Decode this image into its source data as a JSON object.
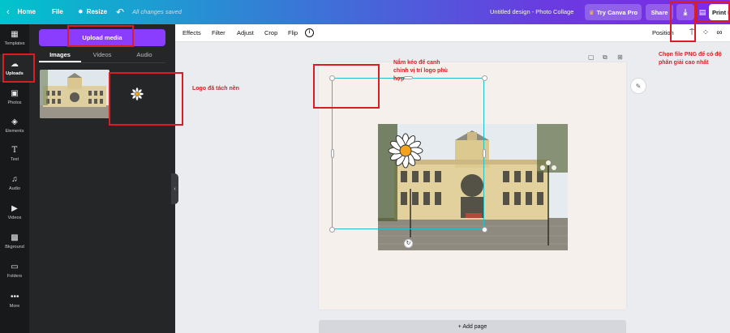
{
  "header": {
    "home": "Home",
    "file": "File",
    "resize": "Resize",
    "saved_status": "All changes saved",
    "design_title": "Untitled design - Photo Collage",
    "try_pro": "Try Canva Pro",
    "share": "Share",
    "print": "Print P"
  },
  "rail": {
    "items": [
      {
        "label": "Templates",
        "icon": "templates-icon"
      },
      {
        "label": "Uploads",
        "icon": "cloud-upload-icon"
      },
      {
        "label": "Photos",
        "icon": "image-icon"
      },
      {
        "label": "Elements",
        "icon": "shapes-icon"
      },
      {
        "label": "Text",
        "icon": "text-icon"
      },
      {
        "label": "Audio",
        "icon": "music-note-icon"
      },
      {
        "label": "Videos",
        "icon": "video-icon"
      },
      {
        "label": "Bkground",
        "icon": "background-icon"
      },
      {
        "label": "Folders",
        "icon": "folder-icon"
      },
      {
        "label": "More",
        "icon": "more-dots-icon"
      }
    ]
  },
  "panel": {
    "upload_button": "Upload media",
    "tabs": [
      {
        "label": "Images",
        "active": true
      },
      {
        "label": "Videos",
        "active": false
      },
      {
        "label": "Audio",
        "active": false
      }
    ]
  },
  "toolbar": {
    "effects": "Effects",
    "filter": "Filter",
    "adjust": "Adjust",
    "crop": "Crop",
    "flip": "Flip",
    "info": "i",
    "position": "Position"
  },
  "canvas": {
    "add_page": "+ Add page"
  },
  "annotations": {
    "logo_note": "Logo đã tách nền",
    "drag_note": [
      "Nắm kéo để canh",
      "chỉnh vị trí logo phù",
      "hợp"
    ],
    "png_note": [
      "Chọn file PNG để có độ",
      "phân giải cao nhất"
    ]
  },
  "colors": {
    "accent": "#8b3dff",
    "selection": "#23c0c7",
    "annotation": "#d91e23"
  }
}
